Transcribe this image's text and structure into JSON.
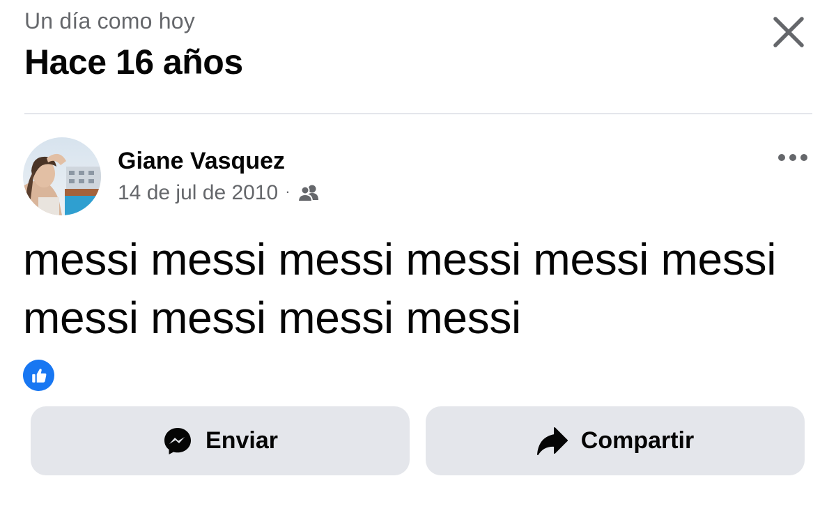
{
  "header": {
    "eyebrow": "Un día como hoy",
    "title": "Hace 16 años",
    "close_icon": "close-icon"
  },
  "post": {
    "author": "Giane Vasquez",
    "date": "14 de jul de 2010",
    "separator": "·",
    "audience_icon": "friends-icon",
    "more_icon": "more-horizontal-icon",
    "text": "messi messi messi messi messi messi messi messi messi messi",
    "reaction_icon": "like-icon"
  },
  "actions": {
    "send_label": "Enviar",
    "share_label": "Compartir",
    "send_icon": "messenger-icon",
    "share_icon": "share-arrow-icon"
  },
  "colors": {
    "text_primary": "#050505",
    "text_secondary": "#65676b",
    "button_bg": "#e4e6eb",
    "like_blue": "#1877f2",
    "divider": "#e4e6eb"
  }
}
